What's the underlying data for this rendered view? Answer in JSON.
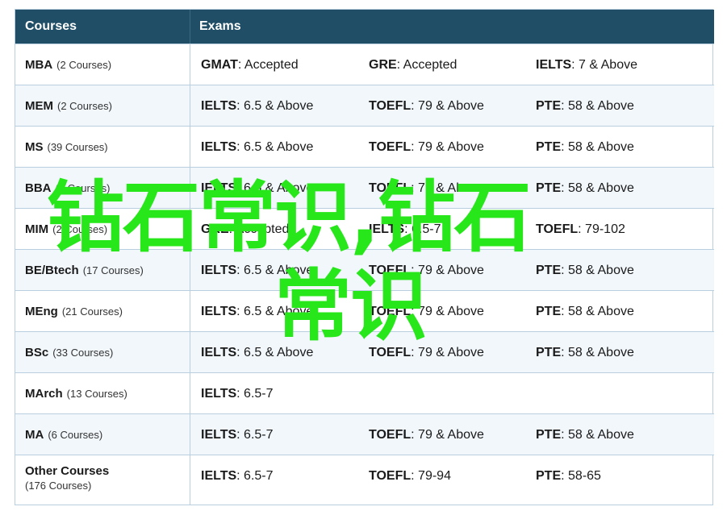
{
  "header": {
    "courses_label": "Courses",
    "exams_label": "Exams"
  },
  "rows": [
    {
      "name": "MBA",
      "count": "(2 Courses)",
      "exams": [
        {
          "name": "GMAT",
          "value": ": Accepted"
        },
        {
          "name": "GRE",
          "value": ": Accepted"
        },
        {
          "name": "IELTS",
          "value": ": 7 & Above"
        }
      ]
    },
    {
      "name": "MEM",
      "count": "(2 Courses)",
      "exams": [
        {
          "name": "IELTS",
          "value": ": 6.5 & Above"
        },
        {
          "name": "TOEFL",
          "value": ": 79 & Above"
        },
        {
          "name": "PTE",
          "value": ": 58 & Above"
        }
      ]
    },
    {
      "name": "MS",
      "count": "(39 Courses)",
      "exams": [
        {
          "name": "IELTS",
          "value": ": 6.5 & Above"
        },
        {
          "name": "TOEFL",
          "value": ": 79 & Above"
        },
        {
          "name": "PTE",
          "value": ": 58 & Above"
        }
      ]
    },
    {
      "name": "BBA",
      "count": "(2 Courses)",
      "exams": [
        {
          "name": "IELTS",
          "value": ": 6.5 & Above"
        },
        {
          "name": "TOEFL",
          "value": ": 79 & Above"
        },
        {
          "name": "PTE",
          "value": ": 58 & Above"
        }
      ]
    },
    {
      "name": "MIM",
      "count": "(2 Courses)",
      "exams": [
        {
          "name": "GRE",
          "value": ": Accepted"
        },
        {
          "name": "IELTS",
          "value": ": 6.5-7"
        },
        {
          "name": "TOEFL",
          "value": ": 79-102"
        }
      ]
    },
    {
      "name": "BE/Btech",
      "count": "(17 Courses)",
      "exams": [
        {
          "name": "IELTS",
          "value": ": 6.5 & Above"
        },
        {
          "name": "TOEFL",
          "value": ": 79 & Above"
        },
        {
          "name": "PTE",
          "value": ": 58 & Above"
        }
      ]
    },
    {
      "name": "MEng",
      "count": "(21 Courses)",
      "exams": [
        {
          "name": "IELTS",
          "value": ": 6.5 & Above"
        },
        {
          "name": "TOEFL",
          "value": ": 79 & Above"
        },
        {
          "name": "PTE",
          "value": ": 58 & Above"
        }
      ]
    },
    {
      "name": "BSc",
      "count": "(33 Courses)",
      "exams": [
        {
          "name": "IELTS",
          "value": ": 6.5 & Above"
        },
        {
          "name": "TOEFL",
          "value": ": 79 & Above"
        },
        {
          "name": "PTE",
          "value": ": 58 & Above"
        }
      ]
    },
    {
      "name": "MArch",
      "count": "(13 Courses)",
      "exams": [
        {
          "name": "IELTS",
          "value": ": 6.5-7"
        }
      ]
    },
    {
      "name": "MA",
      "count": "(6 Courses)",
      "exams": [
        {
          "name": "IELTS",
          "value": ": 6.5-7"
        },
        {
          "name": "TOEFL",
          "value": ": 79 & Above"
        },
        {
          "name": "PTE",
          "value": ": 58 & Above"
        }
      ]
    },
    {
      "name": "Other Courses",
      "count": "(176 Courses)",
      "exams": [
        {
          "name": "IELTS",
          "value": ": 6.5-7"
        },
        {
          "name": "TOEFL",
          "value": ": 79-94"
        },
        {
          "name": "PTE",
          "value": ": 58-65"
        }
      ]
    }
  ],
  "watermark": {
    "line1": "钻石常识,钻石",
    "line2": "常识",
    "color": "#27e61a"
  }
}
